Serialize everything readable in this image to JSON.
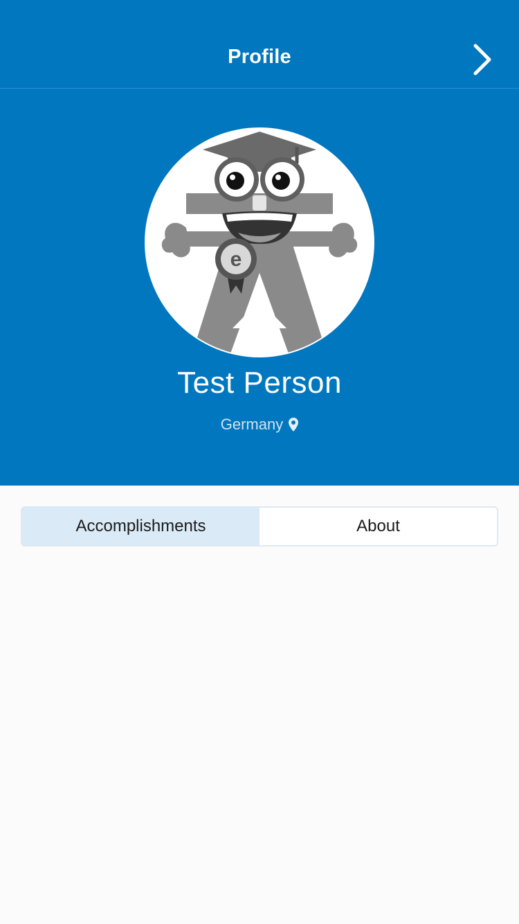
{
  "colors": {
    "primary": "#0077be",
    "segment_active_bg": "#daeaf6",
    "page_bg": "#fbfbfb"
  },
  "nav": {
    "title": "Profile",
    "next_icon": "chevron-right-icon"
  },
  "profile": {
    "name": "Test Person",
    "location": "Germany",
    "location_icon": "map-pin-icon",
    "avatar_icon": "mascot-avatar"
  },
  "tabs": [
    {
      "label": "Accomplishments",
      "active": true
    },
    {
      "label": "About",
      "active": false
    }
  ]
}
